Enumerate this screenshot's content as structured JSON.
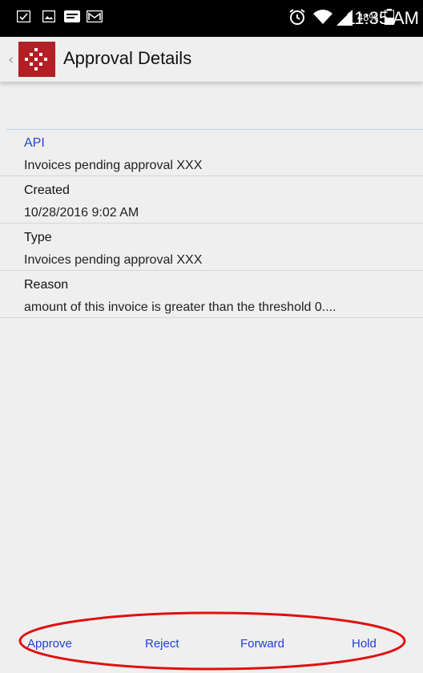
{
  "status_bar": {
    "battery_percent": "48%",
    "time": "11:35 AM"
  },
  "app_bar": {
    "title": "Approval Details"
  },
  "fields": [
    {
      "label": "API",
      "value": "Invoices pending approval XXX"
    },
    {
      "label": "Created",
      "value": "10/28/2016 9:02 AM"
    },
    {
      "label": "Type",
      "value": "Invoices pending approval XXX"
    },
    {
      "label": "Reason",
      "value": "amount of this invoice is greater than the threshold  0...."
    }
  ],
  "actions": {
    "approve": "Approve",
    "reject": "Reject",
    "forward": "Forward",
    "hold": "Hold"
  },
  "colors": {
    "accent": "#1f44e0",
    "logo_red": "#b21f24",
    "highlight_red": "#e01010"
  }
}
